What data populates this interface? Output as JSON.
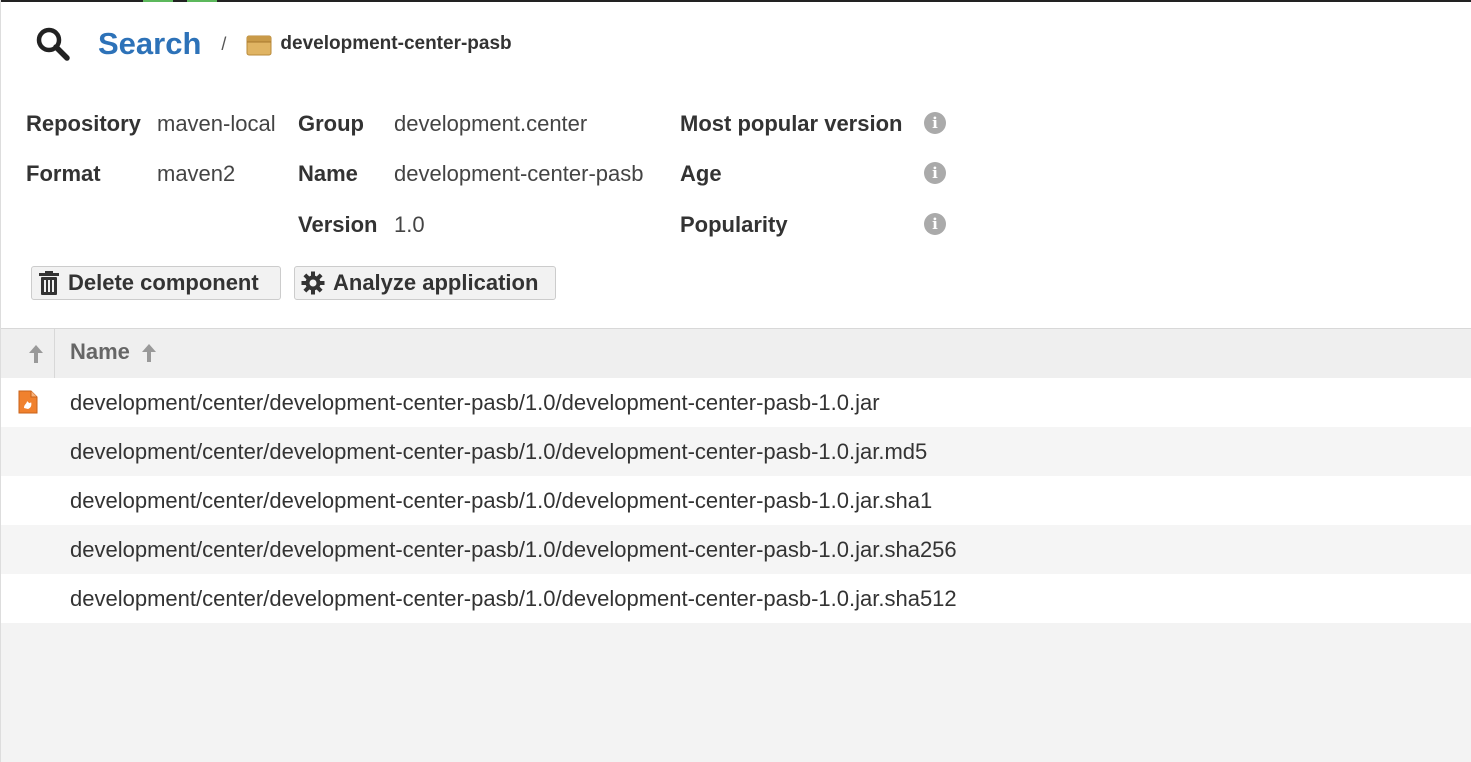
{
  "breadcrumb": {
    "search_label": "Search",
    "separator": "/",
    "current": "development-center-pasb"
  },
  "attributes": {
    "repository_label": "Repository",
    "repository_value": "maven-local",
    "format_label": "Format",
    "format_value": "maven2",
    "group_label": "Group",
    "group_value": "development.center",
    "name_label": "Name",
    "name_value": "development-center-pasb",
    "version_label": "Version",
    "version_value": "1.0",
    "most_popular_label": "Most popular version",
    "age_label": "Age",
    "popularity_label": "Popularity"
  },
  "actions": {
    "delete_label": "Delete component",
    "analyze_label": "Analyze application"
  },
  "table": {
    "name_header": "Name",
    "rows": [
      "development/center/development-center-pasb/1.0/development-center-pasb-1.0.jar",
      "development/center/development-center-pasb/1.0/development-center-pasb-1.0.jar.md5",
      "development/center/development-center-pasb/1.0/development-center-pasb-1.0.jar.sha1",
      "development/center/development-center-pasb/1.0/development-center-pasb-1.0.jar.sha256",
      "development/center/development-center-pasb/1.0/development-center-pasb-1.0.jar.sha512"
    ]
  },
  "icons": {
    "search": "search-icon",
    "component": "package-icon",
    "info": "info-icon",
    "delete": "trash-icon",
    "analyze": "gear-icon",
    "sort": "arrow-up-icon",
    "file": "jar-file-icon"
  },
  "colors": {
    "accent_link": "#2d72b8",
    "status_green": "#5cb85c",
    "file_orange": "#f0812e"
  }
}
